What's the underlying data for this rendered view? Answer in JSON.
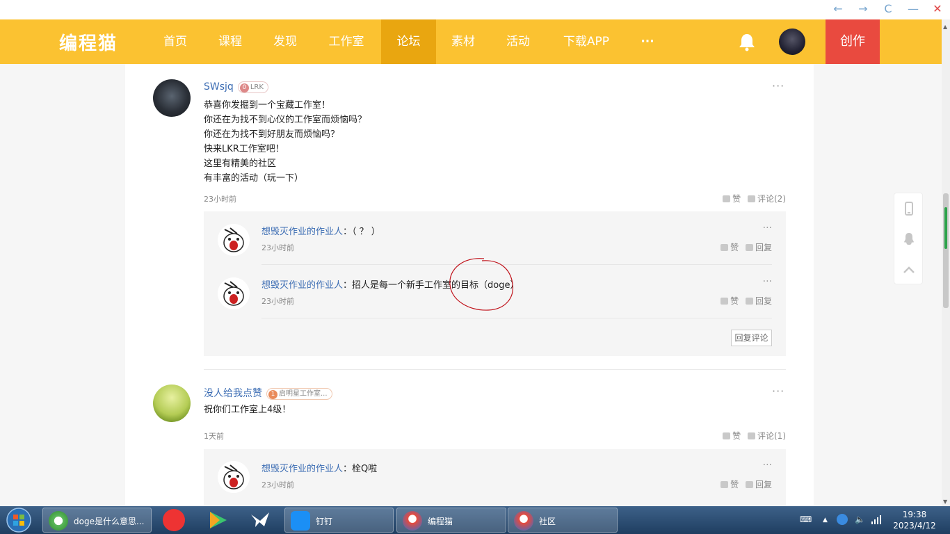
{
  "window": {
    "back": "←",
    "forward": "→",
    "refresh": "C",
    "minimize": "—",
    "close": "✕"
  },
  "nav": {
    "logo": "编程猫",
    "items": [
      {
        "label": "首页",
        "active": false
      },
      {
        "label": "课程",
        "active": false
      },
      {
        "label": "发现",
        "active": false
      },
      {
        "label": "工作室",
        "active": false
      },
      {
        "label": "论坛",
        "active": true
      },
      {
        "label": "素材",
        "active": false
      },
      {
        "label": "活动",
        "active": false
      },
      {
        "label": "下载APP",
        "active": false
      },
      {
        "label": "···",
        "active": false
      }
    ],
    "create_label": "创作",
    "colors": {
      "bar": "#fbc231",
      "active": "#e9a610",
      "create": "#e94a3f"
    }
  },
  "posts": [
    {
      "username": "SWsjq",
      "badge_level": "0",
      "badge_text": "LRK",
      "more": "···",
      "lines": [
        "恭喜你发掘到一个宝藏工作室！",
        "你还在为找不到心仪的工作室而烦恼吗？",
        "你还在为找不到好朋友而烦恼吗？",
        "快来LKR工作室吧！",
        "这里有精美的社区",
        "有丰富的活动（玩一下）"
      ],
      "time": "23小时前",
      "like_label": "赞",
      "comment_label": "评论(2)",
      "replies": [
        {
          "name": "想毁灭作业的作业人",
          "text": "：（ ？ ）",
          "time": "23小时前",
          "like": "赞",
          "reply": "回复",
          "more": "···"
        },
        {
          "name": "想毁灭作业的作业人",
          "text": "：招人是每一个新手工作室的目标（doge）",
          "time": "23小时前",
          "like": "赞",
          "reply": "回复",
          "more": "···"
        }
      ],
      "reply_button": "回复评论"
    },
    {
      "username": "没人给我点赞",
      "badge_level": "1",
      "badge_text": "启明星工作室...",
      "more": "···",
      "lines": [
        "祝你们工作室上4级！"
      ],
      "time": "1天前",
      "like_label": "赞",
      "comment_label": "评论(1)",
      "replies": [
        {
          "name": "想毁灭作业的作业人",
          "text": "：栓Q啦",
          "time": "23小时前",
          "like": "赞",
          "reply": "回复",
          "more": "···"
        }
      ]
    }
  ],
  "taskbar": {
    "tasks": [
      {
        "label": "doge是什么意思...",
        "icon": "browser-icon"
      },
      {
        "label": "钉钉",
        "icon": "dingtalk-icon"
      },
      {
        "label": "编程猫",
        "icon": "codemao-icon"
      },
      {
        "label": "社区",
        "icon": "codemao-icon"
      }
    ],
    "time": "19:38",
    "date": "2023/4/12"
  }
}
